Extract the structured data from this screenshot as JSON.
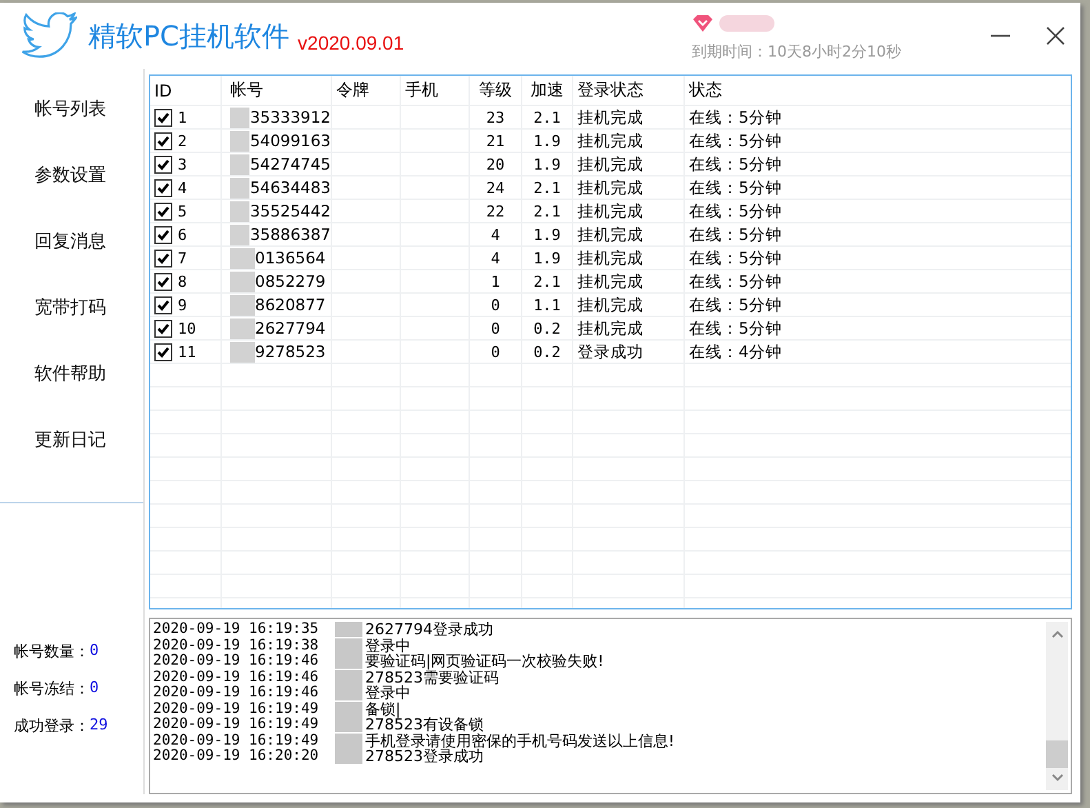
{
  "window": {
    "title": "精软PC挂机软件",
    "version": "v2020.09.01",
    "expiry": "到期时间：10天8小时2分10秒"
  },
  "sidebar": {
    "items": [
      {
        "label": "帐号列表"
      },
      {
        "label": "参数设置"
      },
      {
        "label": "回复消息"
      },
      {
        "label": "宽带打码"
      },
      {
        "label": "软件帮助"
      },
      {
        "label": "更新日记"
      }
    ],
    "stats": [
      {
        "label": "帐号数量：",
        "value": "0"
      },
      {
        "label": "帐号冻结：",
        "value": "0"
      },
      {
        "label": "成功登录：",
        "value": "29"
      }
    ]
  },
  "table": {
    "columns": [
      "ID",
      "帐号",
      "令牌",
      "手机",
      "等级",
      "加速",
      "登录状态",
      "状态"
    ],
    "rows": [
      {
        "checked": true,
        "id": "1",
        "account": "35333912",
        "level": "23",
        "speed": "2.1",
        "login_status": "挂机完成",
        "status": "在线：5分钟"
      },
      {
        "checked": true,
        "id": "2",
        "account": "54099163",
        "level": "21",
        "speed": "1.9",
        "login_status": "挂机完成",
        "status": "在线：5分钟"
      },
      {
        "checked": true,
        "id": "3",
        "account": "54274745",
        "level": "20",
        "speed": "1.9",
        "login_status": "挂机完成",
        "status": "在线：5分钟"
      },
      {
        "checked": true,
        "id": "4",
        "account": "54634483",
        "level": "24",
        "speed": "2.1",
        "login_status": "挂机完成",
        "status": "在线：5分钟"
      },
      {
        "checked": true,
        "id": "5",
        "account": "35525442",
        "level": "22",
        "speed": "2.1",
        "login_status": "挂机完成",
        "status": "在线：5分钟"
      },
      {
        "checked": true,
        "id": "6",
        "account": "35886387",
        "level": "4",
        "speed": "1.9",
        "login_status": "挂机完成",
        "status": "在线：5分钟"
      },
      {
        "checked": true,
        "id": "7",
        "account": "0136564",
        "level": "4",
        "speed": "1.9",
        "login_status": "挂机完成",
        "status": "在线：5分钟"
      },
      {
        "checked": true,
        "id": "8",
        "account": "0852279",
        "level": "1",
        "speed": "2.1",
        "login_status": "挂机完成",
        "status": "在线：5分钟"
      },
      {
        "checked": true,
        "id": "9",
        "account": "8620877",
        "level": "0",
        "speed": "1.1",
        "login_status": "挂机完成",
        "status": "在线：5分钟"
      },
      {
        "checked": true,
        "id": "10",
        "account": "2627794",
        "level": "0",
        "speed": "0.2",
        "login_status": "挂机完成",
        "status": "在线：5分钟"
      },
      {
        "checked": true,
        "id": "11",
        "account": "9278523",
        "level": "0",
        "speed": "0.2",
        "login_status": "登录成功",
        "status": "在线：4分钟"
      }
    ]
  },
  "log": [
    {
      "time": "2020-09-19 16:19:35",
      "message": "2627794登录成功"
    },
    {
      "time": "2020-09-19 16:19:38",
      "message": "登录中"
    },
    {
      "time": "2020-09-19 16:19:46",
      "message": "要验证码|网页验证码一次校验失败!"
    },
    {
      "time": "2020-09-19 16:19:46",
      "message": "278523需要验证码"
    },
    {
      "time": "2020-09-19 16:19:46",
      "message": "登录中"
    },
    {
      "time": "2020-09-19 16:19:49",
      "message": "备锁|"
    },
    {
      "time": "2020-09-19 16:19:49",
      "message": "278523有设备锁"
    },
    {
      "time": "2020-09-19 16:19:49",
      "message": "手机登录请使用密保的手机号码发送以上信息!"
    },
    {
      "time": "2020-09-19 16:20:20",
      "message": "278523登录成功"
    }
  ]
}
